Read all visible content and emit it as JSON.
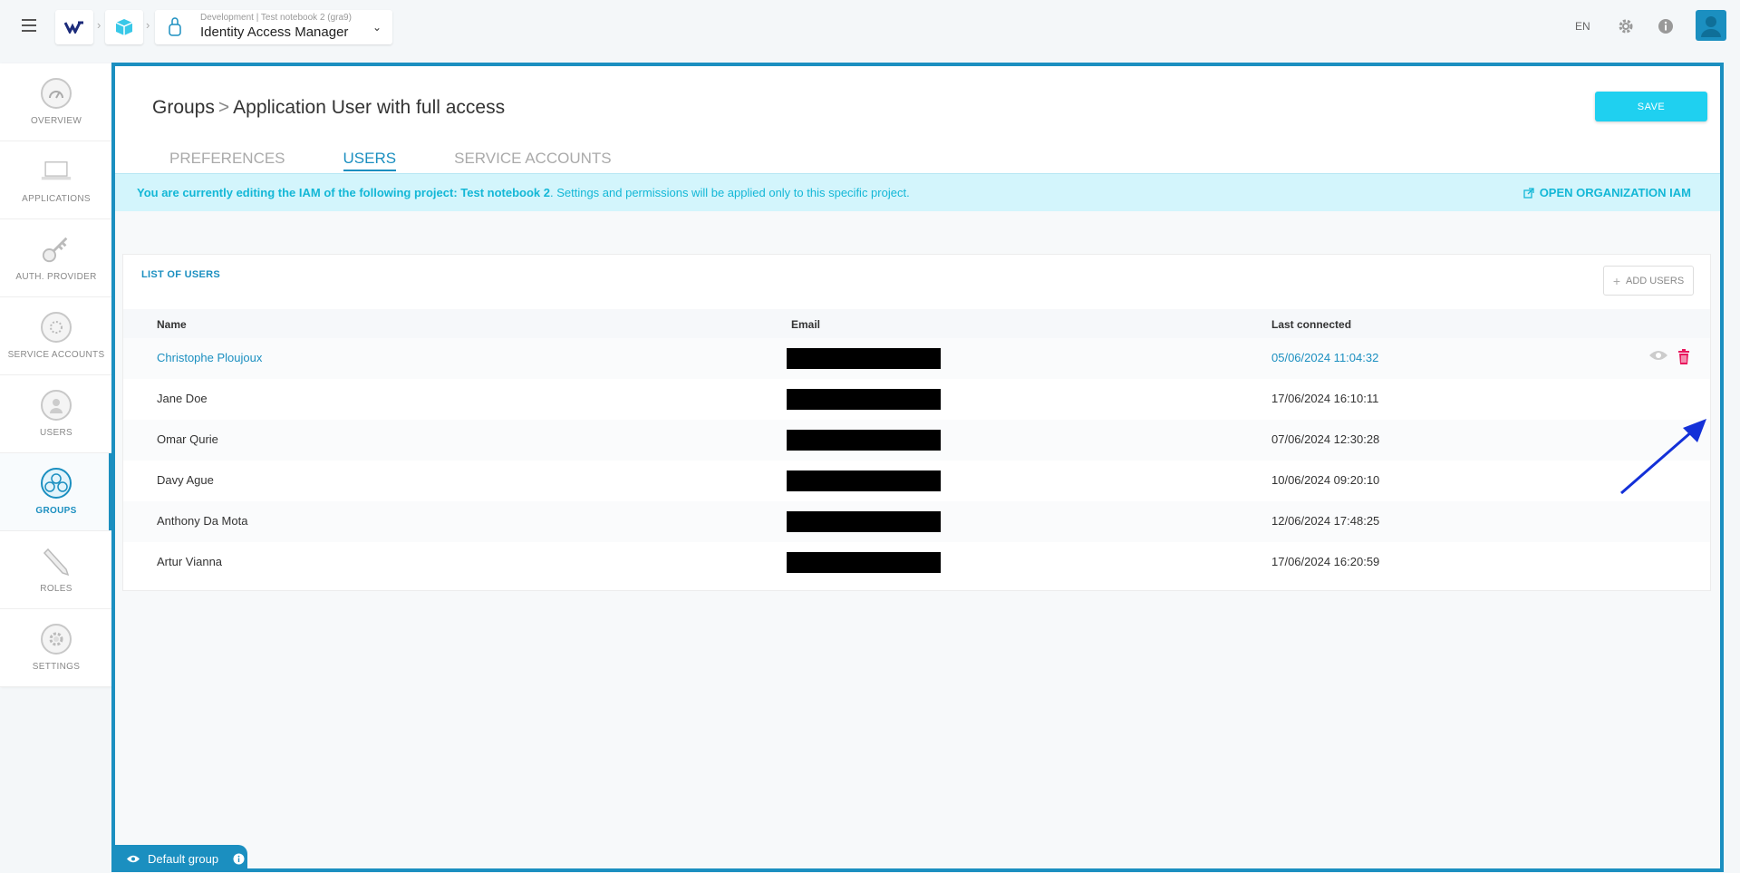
{
  "topbar": {
    "app_sub": "Development | Test notebook 2 (gra9)",
    "app_title": "Identity Access Manager",
    "lang": "EN"
  },
  "sidebar": {
    "items": [
      {
        "label": "OVERVIEW",
        "icon": "gauge-icon"
      },
      {
        "label": "APPLICATIONS",
        "icon": "laptop-icon"
      },
      {
        "label": "AUTH. PROVIDER",
        "icon": "key-icon"
      },
      {
        "label": "SERVICE ACCOUNTS",
        "icon": "service-account-icon"
      },
      {
        "label": "USERS",
        "icon": "user-icon"
      },
      {
        "label": "GROUPS",
        "icon": "group-icon"
      },
      {
        "label": "ROLES",
        "icon": "pencil-icon"
      },
      {
        "label": "SETTINGS",
        "icon": "settings-icon"
      }
    ]
  },
  "header": {
    "breadcrumb_root": "Groups",
    "breadcrumb_current": "Application User with full access",
    "save_label": "SAVE"
  },
  "tabs": [
    {
      "label": "PREFERENCES"
    },
    {
      "label": "USERS"
    },
    {
      "label": "SERVICE ACCOUNTS"
    }
  ],
  "banner": {
    "bold": "You are currently editing the IAM of the following project: Test notebook 2",
    "rest": ". Settings and permissions will be applied only to this specific project.",
    "link": "OPEN ORGANIZATION IAM"
  },
  "users_list": {
    "title": "LIST OF USERS",
    "add_label": "ADD USERS",
    "columns": [
      "Name",
      "Email",
      "Last connected"
    ],
    "rows": [
      {
        "name": "Christophe Ploujoux",
        "last": "05/06/2024 11:04:32"
      },
      {
        "name": "Jane Doe",
        "last": "17/06/2024 16:10:11"
      },
      {
        "name": "Omar Qurie",
        "last": "07/06/2024 12:30:28"
      },
      {
        "name": "Davy Ague",
        "last": "10/06/2024 09:20:10"
      },
      {
        "name": "Anthony Da Mota",
        "last": "12/06/2024 17:48:25"
      },
      {
        "name": "Artur Vianna",
        "last": "17/06/2024 16:20:59"
      }
    ]
  },
  "footer": {
    "default_group": "Default group"
  },
  "colors": {
    "accent": "#1b8fc0",
    "save": "#1fd0f0",
    "banner_bg": "#d3f5fc",
    "delete": "#e8175d",
    "annotation_arrow": "#1330d8"
  }
}
